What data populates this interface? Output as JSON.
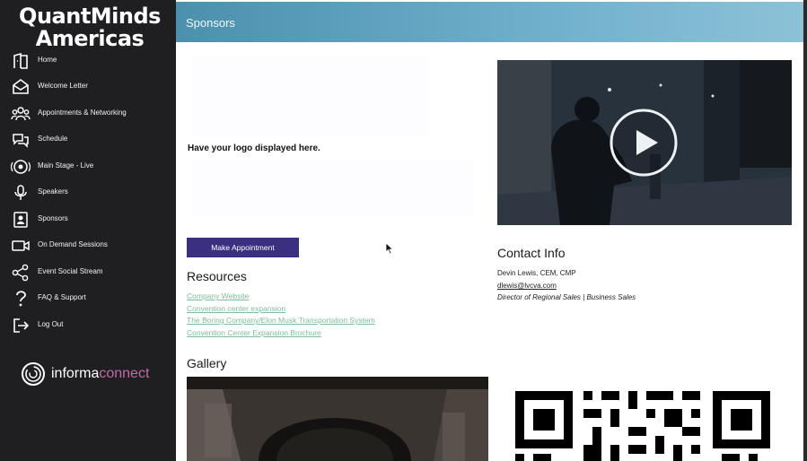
{
  "brand": {
    "line1": "QuantMinds",
    "line2": "Americas"
  },
  "sidebar": {
    "items": [
      {
        "label": "Home",
        "icon": "home-icon"
      },
      {
        "label": "Welcome Letter",
        "icon": "envelope-icon"
      },
      {
        "label": "Appointments & Networking",
        "icon": "people-icon"
      },
      {
        "label": "Schedule",
        "icon": "chat-bubbles-icon"
      },
      {
        "label": "Main Stage - Live",
        "icon": "live-camera-icon"
      },
      {
        "label": "Speakers",
        "icon": "microphone-icon"
      },
      {
        "label": "Sponsors",
        "icon": "contact-card-icon"
      },
      {
        "label": "On Demand Sessions",
        "icon": "video-camera-icon"
      },
      {
        "label": "Event Social Stream",
        "icon": "share-icon"
      },
      {
        "label": "FAQ & Support",
        "icon": "question-icon"
      },
      {
        "label": "Log Out",
        "icon": "logout-icon"
      }
    ]
  },
  "footer_logo": {
    "word1": "informa",
    "word2": "connect"
  },
  "header": {
    "title": "Sponsors"
  },
  "sponsor": {
    "logo_placeholder": "Have your logo displayed here.",
    "appointment_button": "Make Appointment"
  },
  "resources": {
    "title": "Resources",
    "links": [
      "Company Website",
      "Convention center expansion",
      "The Boring Company/Elon Musk Transportation System",
      "Convention Center Expansion Brochure"
    ]
  },
  "gallery": {
    "title": "Gallery"
  },
  "contact": {
    "title": "Contact Info",
    "name": "Devin Lewis, CEM, CMP",
    "email": "dlewis@lvcva.com",
    "role": "Director of Regional Sales | Business Sales"
  },
  "colors": {
    "sidebar": "#1f1f21",
    "header_start": "#4b90ad",
    "header_end": "#8cc2d8",
    "button": "#3a2f80",
    "link": "#7fbc9c",
    "brand_accent": "#c06aa6"
  }
}
